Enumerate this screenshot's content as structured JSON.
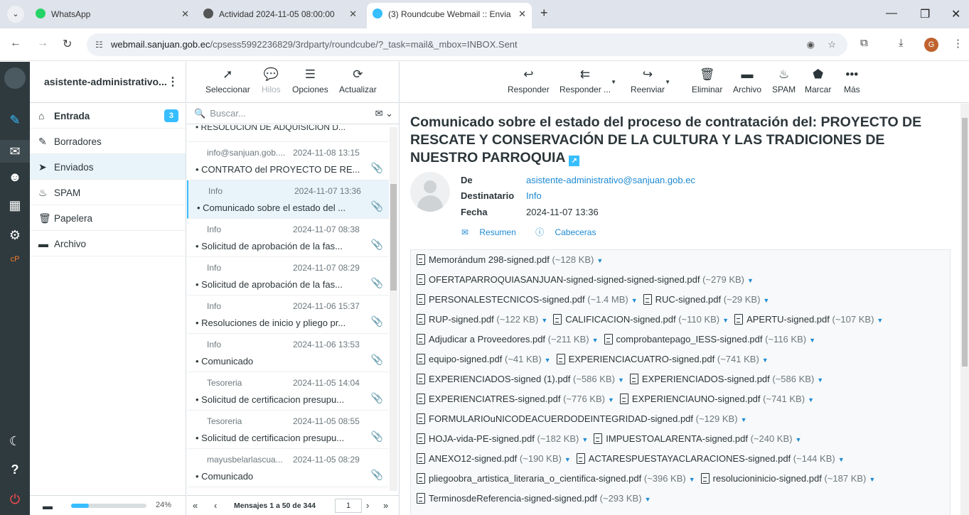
{
  "browser": {
    "tabs": [
      {
        "label": "WhatsApp",
        "favicon_color": "#25d366"
      },
      {
        "label": "Actividad 2024-11-05 08:00:00",
        "favicon_color": "#555555"
      },
      {
        "label": "(3) Roundcube Webmail :: Envia",
        "favicon_color": "#37beff"
      }
    ],
    "url_host": "webmail.sanjuan.gob.ec",
    "url_path": "/cpsess5992236829/3rdparty/roundcube/?_task=mail&_mbox=INBOX.Sent",
    "profile_initial": "G"
  },
  "account": {
    "name": "asistente-administrativo..."
  },
  "folders": [
    {
      "label": "Entrada",
      "icon": "inbox-icon",
      "glyph": "⌂",
      "badge": "3",
      "bold": true
    },
    {
      "label": "Borradores",
      "icon": "pencil-icon",
      "glyph": "✎",
      "badge": "",
      "bold": false
    },
    {
      "label": "Enviados",
      "icon": "paper-plane-icon",
      "glyph": "➤",
      "badge": "",
      "bold": false,
      "selected": true
    },
    {
      "label": "SPAM",
      "icon": "fire-icon",
      "glyph": "♨",
      "badge": "",
      "bold": false
    },
    {
      "label": "Papelera",
      "icon": "trash-icon",
      "glyph": "🗑",
      "badge": "",
      "bold": false
    },
    {
      "label": "Archivo",
      "icon": "archive-icon",
      "glyph": "▬",
      "badge": "",
      "bold": false
    }
  ],
  "quota": {
    "percent_label": "24%",
    "fraction": 0.24
  },
  "list_toolbar": {
    "select": "Seleccionar",
    "threads": "Hilos",
    "options": "Opciones",
    "refresh": "Actualizar"
  },
  "search": {
    "placeholder": "Buscar..."
  },
  "partial_subject": "RESOLUCION DE ADQUISICION D...",
  "messages": [
    {
      "from": "info@sanjuan.gob....",
      "date": "2024-11-08 13:15",
      "subject": "CONTRATO del PROYECTO DE RE..."
    },
    {
      "from": "Info",
      "date": "2024-11-07 13:36",
      "subject": "Comunicado sobre el estado del ...",
      "selected": true
    },
    {
      "from": "Info",
      "date": "2024-11-07 08:38",
      "subject": "Solicitud de aprobación de la fas..."
    },
    {
      "from": "Info",
      "date": "2024-11-07 08:29",
      "subject": "Solicitud de aprobación de la fas..."
    },
    {
      "from": "Info",
      "date": "2024-11-06 15:37",
      "subject": "Resoluciones de inicio y pliego pr..."
    },
    {
      "from": "Info",
      "date": "2024-11-06 13:53",
      "subject": "Comunicado"
    },
    {
      "from": "Tesoreria",
      "date": "2024-11-05 14:04",
      "subject": "Solicitud de certificacion presupu..."
    },
    {
      "from": "Tesoreria",
      "date": "2024-11-05 08:55",
      "subject": "Solicitud de certificacion presupu..."
    },
    {
      "from": "mayusbelarlascua...",
      "date": "2024-11-05 08:29",
      "subject": "Comunicado"
    }
  ],
  "list_footer": {
    "count": "Mensajes 1 a 50 de 344",
    "page": "1"
  },
  "preview_toolbar": {
    "reply": "Responder",
    "reply_all": "Responder ...",
    "forward": "Reenviar",
    "delete": "Eliminar",
    "archive": "Archivo",
    "spam": "SPAM",
    "mark": "Marcar",
    "more": "Más"
  },
  "email": {
    "subject": "Comunicado sobre el estado del proceso de contratación del: PROYECTO DE RESCATE Y CONSERVACIÓN DE LA CULTURA Y LAS TRADICIONES DE NUESTRO PARROQUIA",
    "from_label": "De",
    "from": "asistente-administrativo@sanjuan.gob.ec",
    "to_label": "Destinatario",
    "to": "Info",
    "date_label": "Fecha",
    "date": "2024-11-07 13:36",
    "summary_link": "Resumen",
    "headers_link": "Cabeceras"
  },
  "attachment_rows": [
    [
      {
        "name": "Memorándum 298-signed.pdf",
        "size": "(~128 KB)"
      }
    ],
    [
      {
        "name": "OFERTAPARROQUIASANJUAN-signed-signed-signed-signed.pdf",
        "size": "(~279 KB)"
      }
    ],
    [
      {
        "name": "PERSONALESTECNICOS-signed.pdf",
        "size": "(~1.4 MB)"
      },
      {
        "name": "RUC-signed.pdf",
        "size": "(~29 KB)"
      }
    ],
    [
      {
        "name": "RUP-signed.pdf",
        "size": "(~122 KB)"
      },
      {
        "name": "CALIFICACION-signed.pdf",
        "size": "(~110 KB)"
      },
      {
        "name": "APERTU-signed.pdf",
        "size": "(~107 KB)"
      }
    ],
    [
      {
        "name": "Adjudicar a Proveedores.pdf",
        "size": "(~211 KB)"
      },
      {
        "name": "comprobantepago_IESS-signed.pdf",
        "size": "(~116 KB)"
      }
    ],
    [
      {
        "name": "equipo-signed.pdf",
        "size": "(~41 KB)"
      },
      {
        "name": "EXPERIENCIACUATRO-signed.pdf",
        "size": "(~741 KB)"
      }
    ],
    [
      {
        "name": "EXPERIENCIADOS-signed (1).pdf",
        "size": "(~586 KB)"
      },
      {
        "name": "EXPERIENCIADOS-signed.pdf",
        "size": "(~586 KB)"
      }
    ],
    [
      {
        "name": "EXPERIENCIATRES-signed.pdf",
        "size": "(~776 KB)"
      },
      {
        "name": "EXPERIENCIAUNO-signed.pdf",
        "size": "(~741 KB)"
      }
    ],
    [
      {
        "name": "FORMULARIOuNICODEACUERDODEINTEGRIDAD-signed.pdf",
        "size": "(~129 KB)"
      }
    ],
    [
      {
        "name": "HOJA-vida-PE-signed.pdf",
        "size": "(~182 KB)"
      },
      {
        "name": "IMPUESTOALARENTA-signed.pdf",
        "size": "(~240 KB)"
      }
    ],
    [
      {
        "name": "ANEXO12-signed.pdf",
        "size": "(~190 KB)"
      },
      {
        "name": "ACTARESPUESTAYACLARACIONES-signed.pdf",
        "size": "(~144 KB)"
      }
    ],
    [
      {
        "name": "pliegoobra_artistica_literaria_o_cientifica-signed.pdf",
        "size": "(~396 KB)"
      },
      {
        "name": "resolucioninicio-signed.pdf",
        "size": "(~187 KB)"
      }
    ],
    [
      {
        "name": "TerminosdeReferencia-signed-signed.pdf",
        "size": "(~293 KB)"
      }
    ]
  ],
  "colors": {
    "accent": "#37beff",
    "rail": "#2f3a3f",
    "selected_row": "#e9f3fa"
  }
}
